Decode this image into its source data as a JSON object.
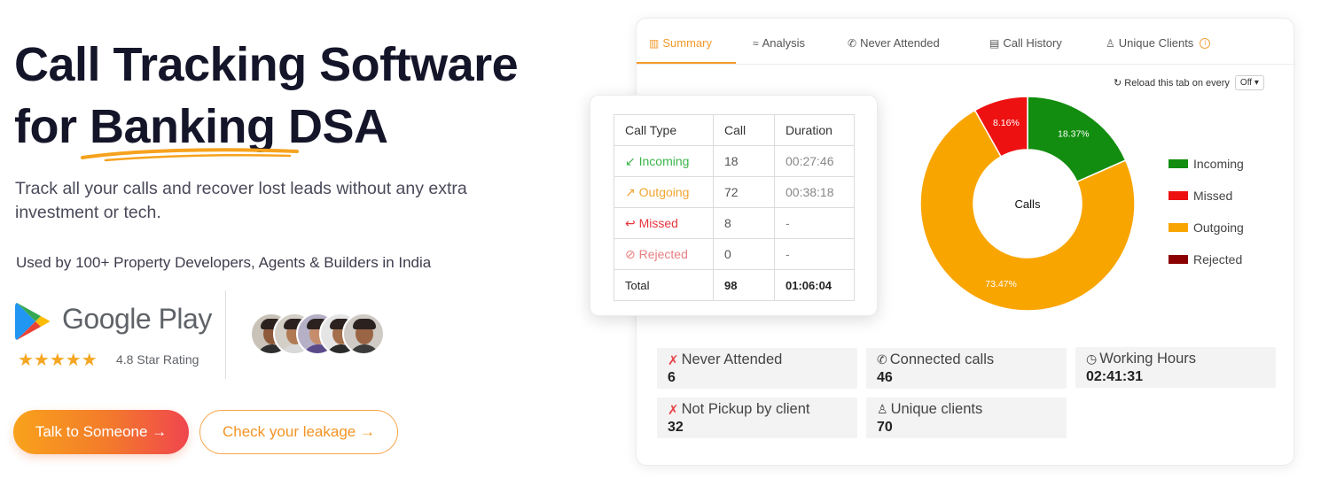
{
  "hero": {
    "title_line1": "Call Tracking Software",
    "title_line2_prefix": "for ",
    "title_highlight": "Banking",
    "title_line2_suffix": " DSA",
    "subtitle": "Track all your calls and recover lost leads without any extra investment or tech.",
    "used_by": "Used by 100+ Property Developers, Agents & Builders in India"
  },
  "google_play": {
    "store_name": "Google Play",
    "stars": "★★★★★",
    "rating_text": "4.8 Star Rating",
    "rating_value": 4.8
  },
  "avatars": [
    {
      "skin": "#8d5a3b",
      "shirt": "#2f2f2f",
      "bg": "#c9c2b8"
    },
    {
      "skin": "#b07a55",
      "shirt": "#d9d9d9",
      "bg": "#d3cec6"
    },
    {
      "skin": "#c58d6b",
      "shirt": "#5b4a8a",
      "bg": "#b6b0c7"
    },
    {
      "skin": "#a36f4d",
      "shirt": "#2a2a2a",
      "bg": "#e5e5e5"
    },
    {
      "skin": "#9a6545",
      "shirt": "#3b3b3b",
      "bg": "#cfcac4"
    }
  ],
  "buttons": {
    "primary": "Talk to Someone →",
    "secondary": "Check your leakage →"
  },
  "dashboard": {
    "tabs": [
      {
        "label": "Summary",
        "icon": "bar-chart-icon",
        "glyph": "▥"
      },
      {
        "label": "Analysis",
        "icon": "trend-icon",
        "glyph": "≈"
      },
      {
        "label": "Never Attended",
        "icon": "phone-off-icon",
        "glyph": "✆"
      },
      {
        "label": "Call History",
        "icon": "document-icon",
        "glyph": "▤"
      },
      {
        "label": "Unique Clients",
        "icon": "user-icon",
        "glyph": "♙"
      }
    ],
    "info_glyph": "i",
    "reload_label": "Reload this tab on every",
    "reload_icon": "↻",
    "reload_value": "Off",
    "stats": [
      {
        "label": "Never Attended",
        "value": "6",
        "icon": "missed-call-icon",
        "glyph": "✗"
      },
      {
        "label": "Connected calls",
        "value": "46",
        "icon": "phone-icon",
        "glyph": "✆"
      },
      {
        "label": "Working Hours",
        "value": "02:41:31",
        "icon": "clock-icon",
        "glyph": "◷"
      },
      {
        "label": "Not Pickup by client",
        "value": "32",
        "icon": "missed-call-icon",
        "glyph": "✗"
      },
      {
        "label": "Unique clients",
        "value": "70",
        "icon": "user-icon",
        "glyph": "♙"
      }
    ]
  },
  "call_table": {
    "headers": [
      "Call Type",
      "Call",
      "Duration"
    ],
    "rows": [
      {
        "type": "Incoming",
        "glyph": "↙",
        "call": "18",
        "duration": "00:27:46",
        "cls": "c-in"
      },
      {
        "type": "Outgoing",
        "glyph": "↗",
        "call": "72",
        "duration": "00:38:18",
        "cls": "c-out"
      },
      {
        "type": "Missed",
        "glyph": "↩",
        "call": "8",
        "duration": "-",
        "cls": "c-miss"
      },
      {
        "type": "Rejected",
        "glyph": "⊘",
        "call": "0",
        "duration": "-",
        "cls": "c-rej"
      }
    ],
    "total": {
      "label": "Total",
      "call": "98",
      "duration": "01:06:04"
    }
  },
  "chart_data": {
    "type": "pie",
    "title": "",
    "center_label": "Calls",
    "slices": [
      {
        "name": "Incoming",
        "value": 18.37,
        "label": "18.37%",
        "color": "#128d0f"
      },
      {
        "name": "Outgoing",
        "value": 73.47,
        "label": "73.47%",
        "color": "#f9a500"
      },
      {
        "name": "Missed",
        "value": 8.16,
        "label": "8.16%",
        "color": "#ee1111"
      },
      {
        "name": "Rejected",
        "value": 0,
        "label": "",
        "color": "#8b0000"
      }
    ],
    "legend": [
      {
        "name": "Incoming",
        "color": "#128d0f"
      },
      {
        "name": "Missed",
        "color": "#ee1111"
      },
      {
        "name": "Outgoing",
        "color": "#f9a500"
      },
      {
        "name": "Rejected",
        "color": "#8b0000"
      }
    ],
    "legend_position": "right",
    "colors": {
      "accent": "#f39a2b",
      "brand_gradient_start": "#f9a21b",
      "brand_gradient_end": "#f0454e"
    }
  }
}
